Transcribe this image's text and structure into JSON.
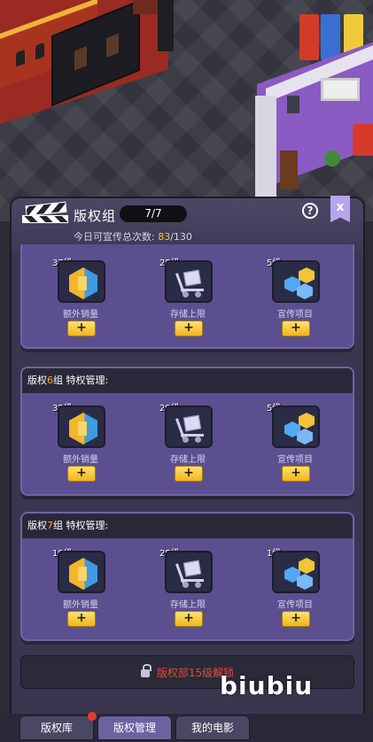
{
  "header": {
    "title": "版权组",
    "count": "7/7",
    "sub_prefix": "今日可宣传总次数:",
    "sub_current": "83",
    "sub_total": "/130",
    "help": "?",
    "close": "x"
  },
  "cards": [
    {
      "heading_pre": "",
      "heading_num": "",
      "heading_post": "",
      "items": [
        {
          "level": "37级",
          "label": "额外销量",
          "icon": "box-icon"
        },
        {
          "level": "25级",
          "label": "存储上限",
          "icon": "cart-icon"
        },
        {
          "level": "5级",
          "label": "宣传项目",
          "icon": "promo-icon"
        }
      ]
    },
    {
      "heading_pre": "版权",
      "heading_num": "6",
      "heading_post": "组 特权管理:",
      "items": [
        {
          "level": "32级",
          "label": "额外销量",
          "icon": "box-icon"
        },
        {
          "level": "29级",
          "label": "存储上限",
          "icon": "cart-icon"
        },
        {
          "level": "5级",
          "label": "宣传项目",
          "icon": "promo-icon"
        }
      ]
    },
    {
      "heading_pre": "版权",
      "heading_num": "7",
      "heading_post": "组 特权管理:",
      "items": [
        {
          "level": "19级",
          "label": "额外销量",
          "icon": "box-icon"
        },
        {
          "level": "25级",
          "label": "存储上限",
          "icon": "cart-icon"
        },
        {
          "level": "1级",
          "label": "宣传项目",
          "icon": "promo-icon"
        }
      ]
    }
  ],
  "upgrade_label": "+",
  "locked": {
    "text": "版权部15级解锁"
  },
  "watermark": "biubiu",
  "tabs": [
    {
      "label": "版权库",
      "active": false
    },
    {
      "label": "版权管理",
      "active": true
    },
    {
      "label": "我的电影",
      "active": false
    }
  ],
  "colors": {
    "accent_gold": "#f4c53a",
    "locked_text": "#e2493a",
    "badge": "#e33b2b"
  }
}
